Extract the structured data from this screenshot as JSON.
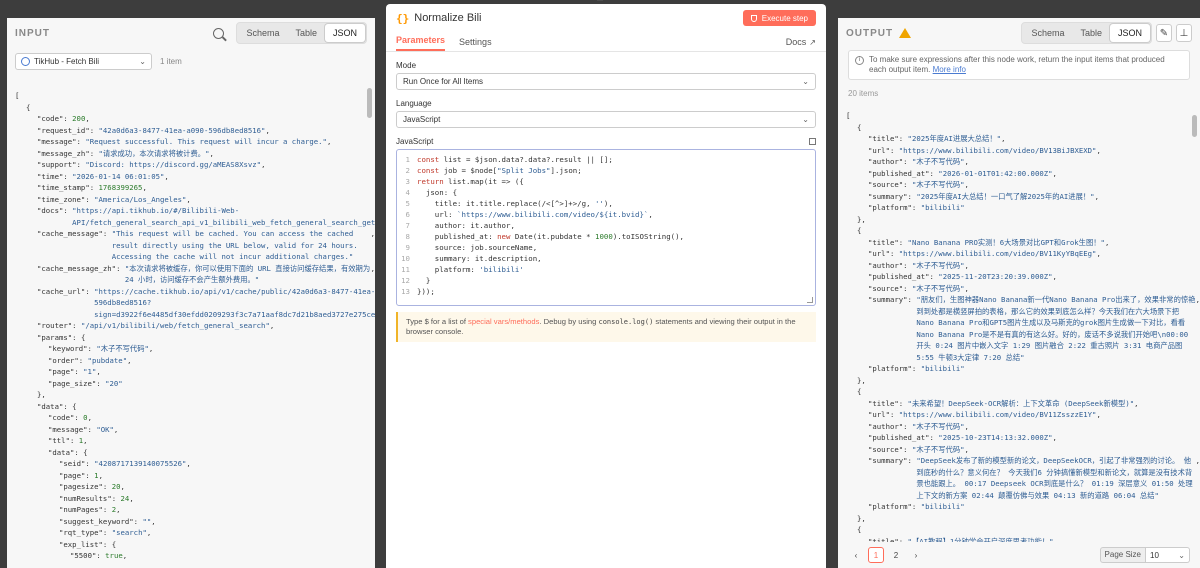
{
  "input_panel": {
    "title": "INPUT",
    "tabs": [
      "Schema",
      "Table",
      "JSON"
    ],
    "active_tab": "JSON",
    "node_select": "TikHub - Fetch Bili",
    "item_count": "1 item",
    "lines": [
      {
        "i": 0,
        "t": "["
      },
      {
        "i": 1,
        "t": "{"
      },
      {
        "i": 2,
        "k": "\"code\": ",
        "v": "200",
        "ty": "n",
        "c": ","
      },
      {
        "i": 2,
        "k": "\"request_id\": ",
        "v": "\"42a0d6a3-8477-41ea-a090-596db8ed8516\"",
        "c": ","
      },
      {
        "i": 2,
        "k": "\"message\": ",
        "v": "\"Request successful. This request will incur a charge.\"",
        "c": ","
      },
      {
        "i": 2,
        "k": "\"message_zh\": ",
        "v": "\"请求成功，本次请求将被计费。\"",
        "c": ","
      },
      {
        "i": 2,
        "k": "\"support\": ",
        "v": "\"Discord: https://discord.gg/aMEAS8Xsvz\"",
        "c": ","
      },
      {
        "i": 2,
        "k": "\"time\": ",
        "v": "\"2026-01-14 06:01:05\"",
        "c": ","
      },
      {
        "i": 2,
        "k": "\"time_stamp\": ",
        "v": "1768399265",
        "ty": "n",
        "c": ","
      },
      {
        "i": 2,
        "k": "\"time_zone\": ",
        "v": "\"America/Los_Angeles\"",
        "c": ","
      },
      {
        "i": 2,
        "k": "\"docs\": ",
        "v": "\"https://api.tikhub.io/#/Bilibili-Web-API/fetch_general_search_api_v1_bilibili_web_fetch_general_search_get\"",
        "c": ","
      },
      {
        "i": 2,
        "k": "\"cache_message\": ",
        "v": "\"This request will be cached. You can access the cached result directly using the URL below, valid for 24 hours. Accessing the cache will not incur additional charges.\"",
        "c": ","
      },
      {
        "i": 2,
        "k": "\"cache_message_zh\": ",
        "v": "\"本次请求将被缓存，你可以使用下面的 URL 直接访问缓存结果，有效期为 24 小时，访问缓存不会产生额外费用。\"",
        "c": ","
      },
      {
        "i": 2,
        "k": "\"cache_url\": ",
        "v": "\"https://cache.tikhub.io/api/v1/cache/public/42a0d6a3-8477-41ea-a090-596db8ed8516?sign=d3922f6e4485df30efdd0209293f3c7a71aaf8dc7d21b8aed3727e275ce9cdda\"",
        "c": ","
      },
      {
        "i": 2,
        "k": "\"router\": ",
        "v": "\"/api/v1/bilibili/web/fetch_general_search\"",
        "c": ","
      },
      {
        "i": 2,
        "k": "\"params\": ",
        "p": "{"
      },
      {
        "i": 3,
        "k": "\"keyword\": ",
        "v": "\"木子不写代码\"",
        "c": ","
      },
      {
        "i": 3,
        "k": "\"order\": ",
        "v": "\"pubdate\"",
        "c": ","
      },
      {
        "i": 3,
        "k": "\"page\": ",
        "v": "\"1\"",
        "c": ","
      },
      {
        "i": 3,
        "k": "\"page_size\": ",
        "v": "\"20\""
      },
      {
        "i": 2,
        "t": "},"
      },
      {
        "i": 2,
        "k": "\"data\": ",
        "p": "{"
      },
      {
        "i": 3,
        "k": "\"code\": ",
        "v": "0",
        "ty": "n",
        "c": ","
      },
      {
        "i": 3,
        "k": "\"message\": ",
        "v": "\"OK\"",
        "c": ","
      },
      {
        "i": 3,
        "k": "\"ttl\": ",
        "v": "1",
        "ty": "n",
        "c": ","
      },
      {
        "i": 3,
        "k": "\"data\": ",
        "p": "{"
      },
      {
        "i": 4,
        "k": "\"seid\": ",
        "v": "\"4208717139140075526\"",
        "c": ","
      },
      {
        "i": 4,
        "k": "\"page\": ",
        "v": "1",
        "ty": "n",
        "c": ","
      },
      {
        "i": 4,
        "k": "\"pagesize\": ",
        "v": "20",
        "ty": "n",
        "c": ","
      },
      {
        "i": 4,
        "k": "\"numResults\": ",
        "v": "24",
        "ty": "n",
        "c": ","
      },
      {
        "i": 4,
        "k": "\"numPages\": ",
        "v": "2",
        "ty": "n",
        "c": ","
      },
      {
        "i": 4,
        "k": "\"suggest_keyword\": ",
        "v": "\"\"",
        "c": ","
      },
      {
        "i": 4,
        "k": "\"rqt_type\": ",
        "v": "\"search\"",
        "c": ","
      },
      {
        "i": 4,
        "k": "\"exp_list\": ",
        "p": "{"
      },
      {
        "i": 5,
        "k": "\"5500\": ",
        "v": "true",
        "ty": "n",
        "c": ","
      }
    ]
  },
  "modal": {
    "title": "Normalize Bili",
    "execute_label": "Execute step",
    "tabs": [
      "Parameters",
      "Settings"
    ],
    "active_tab": "Parameters",
    "docs_label": "Docs",
    "mode_label": "Mode",
    "mode_value": "Run Once for All Items",
    "language_label": "Language",
    "language_value": "JavaScript",
    "code_label": "JavaScript",
    "code_lines": [
      "const list = $json.data?.data?.result || [];",
      "const job = $node[\"Split Jobs\"].json;",
      "return list.map(it => ({",
      "  json: {",
      "    title: it.title.replace(/<[^>]+>/g, ''),",
      "    url: `https://www.bilibili.com/video/${it.bvid}`,",
      "    author: it.author,",
      "    published_at: new Date(it.pubdate * 1000).toISOString(),",
      "    source: job.sourceName,",
      "    summary: it.description,",
      "    platform: 'bilibili'",
      "  }",
      "}));"
    ],
    "hint_prefix": "Type $ for a list of ",
    "hint_link": "special vars/methods",
    "hint_middle": ". Debug by using ",
    "hint_code": "console.log()",
    "hint_suffix": " statements and viewing their output in the browser console."
  },
  "output_panel": {
    "title": "OUTPUT",
    "tabs": [
      "Schema",
      "Table",
      "JSON"
    ],
    "active_tab": "JSON",
    "notice_text": "To make sure expressions after this node work, return the input items that produced each output item.",
    "notice_link": "More info",
    "items_label": "20 items",
    "lines": [
      {
        "i": 0,
        "t": "["
      },
      {
        "i": 1,
        "t": "{"
      },
      {
        "i": 2,
        "k": "\"title\": ",
        "v": "\"2025年度AI进展大总结！\"",
        "c": ","
      },
      {
        "i": 2,
        "k": "\"url\": ",
        "v": "\"https://www.bilibili.com/video/BV13BiJBXEXD\"",
        "c": ","
      },
      {
        "i": 2,
        "k": "\"author\": ",
        "v": "\"木子不写代码\"",
        "c": ","
      },
      {
        "i": 2,
        "k": "\"published_at\": ",
        "v": "\"2026-01-01T01:42:00.000Z\"",
        "c": ","
      },
      {
        "i": 2,
        "k": "\"source\": ",
        "v": "\"木子不写代码\"",
        "c": ","
      },
      {
        "i": 2,
        "k": "\"summary\": ",
        "v": "\"2025年度AI大总结！一口气了解2025年的AI进展！\"",
        "c": ","
      },
      {
        "i": 2,
        "k": "\"platform\": ",
        "v": "\"bilibili\""
      },
      {
        "i": 1,
        "t": "},"
      },
      {
        "i": 1,
        "t": "{"
      },
      {
        "i": 2,
        "k": "\"title\": ",
        "v": "\"Nano Banana PRO实测！6大场景对比GPT和Grok生图！\"",
        "c": ","
      },
      {
        "i": 2,
        "k": "\"url\": ",
        "v": "\"https://www.bilibili.com/video/BV11KyYBqEEg\"",
        "c": ","
      },
      {
        "i": 2,
        "k": "\"author\": ",
        "v": "\"木子不写代码\"",
        "c": ","
      },
      {
        "i": 2,
        "k": "\"published_at\": ",
        "v": "\"2025-11-20T23:20:39.000Z\"",
        "c": ","
      },
      {
        "i": 2,
        "k": "\"source\": ",
        "v": "\"木子不写代码\"",
        "c": ","
      },
      {
        "i": 2,
        "k": "\"summary\": ",
        "v": "\"朋友们，生图神器Nano Banana新一代Nano Banana Pro出来了，效果非常的惊艳到到处都是横竖屏拍的表格，那么它的效果到底怎么样？今天我们在六大场景下把Nano Banana Pro和GPT5图片生成以及马斯克的grok图片生成做一下对比，看看Nano Banana Pro是不是有真的有这么好。好的，废话不多说我们开始吧\\n00:00 开头 0:24 图片中嵌入文字 1:29 图片融合 2:22 重古照片 3:31 电商产品图 5:55 牛顿3大定律 7:20 总结\"",
        "c": ","
      },
      {
        "i": 2,
        "k": "\"platform\": ",
        "v": "\"bilibili\""
      },
      {
        "i": 1,
        "t": "},"
      },
      {
        "i": 1,
        "t": "{"
      },
      {
        "i": 2,
        "k": "\"title\": ",
        "v": "\"未来希望！DeepSeek-OCR解析：上下文革命 (DeepSeek新模型)\"",
        "c": ","
      },
      {
        "i": 2,
        "k": "\"url\": ",
        "v": "\"https://www.bilibili.com/video/BV11ZsszzE1Y\"",
        "c": ","
      },
      {
        "i": 2,
        "k": "\"author\": ",
        "v": "\"木子不写代码\"",
        "c": ","
      },
      {
        "i": 2,
        "k": "\"published_at\": ",
        "v": "\"2025-10-23T14:13:32.000Z\"",
        "c": ","
      },
      {
        "i": 2,
        "k": "\"source\": ",
        "v": "\"木子不写代码\"",
        "c": ","
      },
      {
        "i": 2,
        "k": "\"summary\": ",
        "v": "\"DeepSeek发布了新的模型新的论文，DeepSeekOCR，引起了非常强烈的讨论。 他到底秒的什么？意义何在？ 今天我们6 分钟搞懂新模型和新论文，就算是没有技术背景也能跟上。 00:17 Deepseek OCR到底是什么？ 01:19 深层意义 01:50 处理上下文的新方案 02:44 颠覆仿佛与效果 04:13 新的道路 06:04 总结\"",
        "c": ","
      },
      {
        "i": 2,
        "k": "\"platform\": ",
        "v": "\"bilibili\""
      },
      {
        "i": 1,
        "t": "},"
      },
      {
        "i": 1,
        "t": "{"
      },
      {
        "i": 2,
        "k": "\"title\": ",
        "v": "\"【AI教程】1分钟学会开启深度思考功能！\"",
        "c": ","
      }
    ],
    "pages": [
      "1",
      "2"
    ],
    "active_page": "1",
    "page_size_label": "Page Size",
    "page_size_value": "10"
  },
  "colors": {
    "accent": "#ff6d5a",
    "warning": "#f0a500",
    "string": "#2e5d93"
  }
}
